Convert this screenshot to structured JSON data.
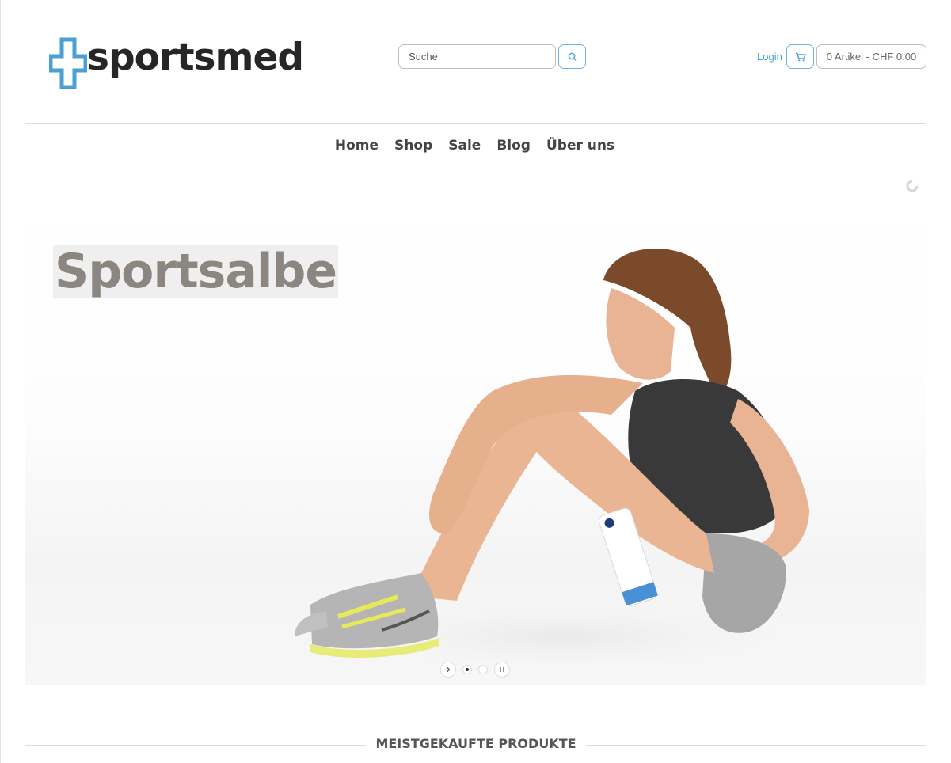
{
  "brand": {
    "name": "sportsmed",
    "cross_color": "#4a9fd3",
    "accent": "#4aa3d8"
  },
  "header": {
    "search_placeholder": "Suche",
    "search_icon": "search-icon",
    "login_label": "Login",
    "cart_icon": "cart-icon",
    "cart_summary": "0 Artikel - CHF 0.00"
  },
  "nav": {
    "items": [
      {
        "label": "Home"
      },
      {
        "label": "Shop"
      },
      {
        "label": "Sale"
      },
      {
        "label": "Blog"
      },
      {
        "label": "Über uns"
      }
    ]
  },
  "hero": {
    "title": "Sportsalbe",
    "slides_count": 2,
    "active_slide": 1
  },
  "sections": {
    "bestsellers_title": "MEISTGEKAUFTE PRODUKTE"
  }
}
